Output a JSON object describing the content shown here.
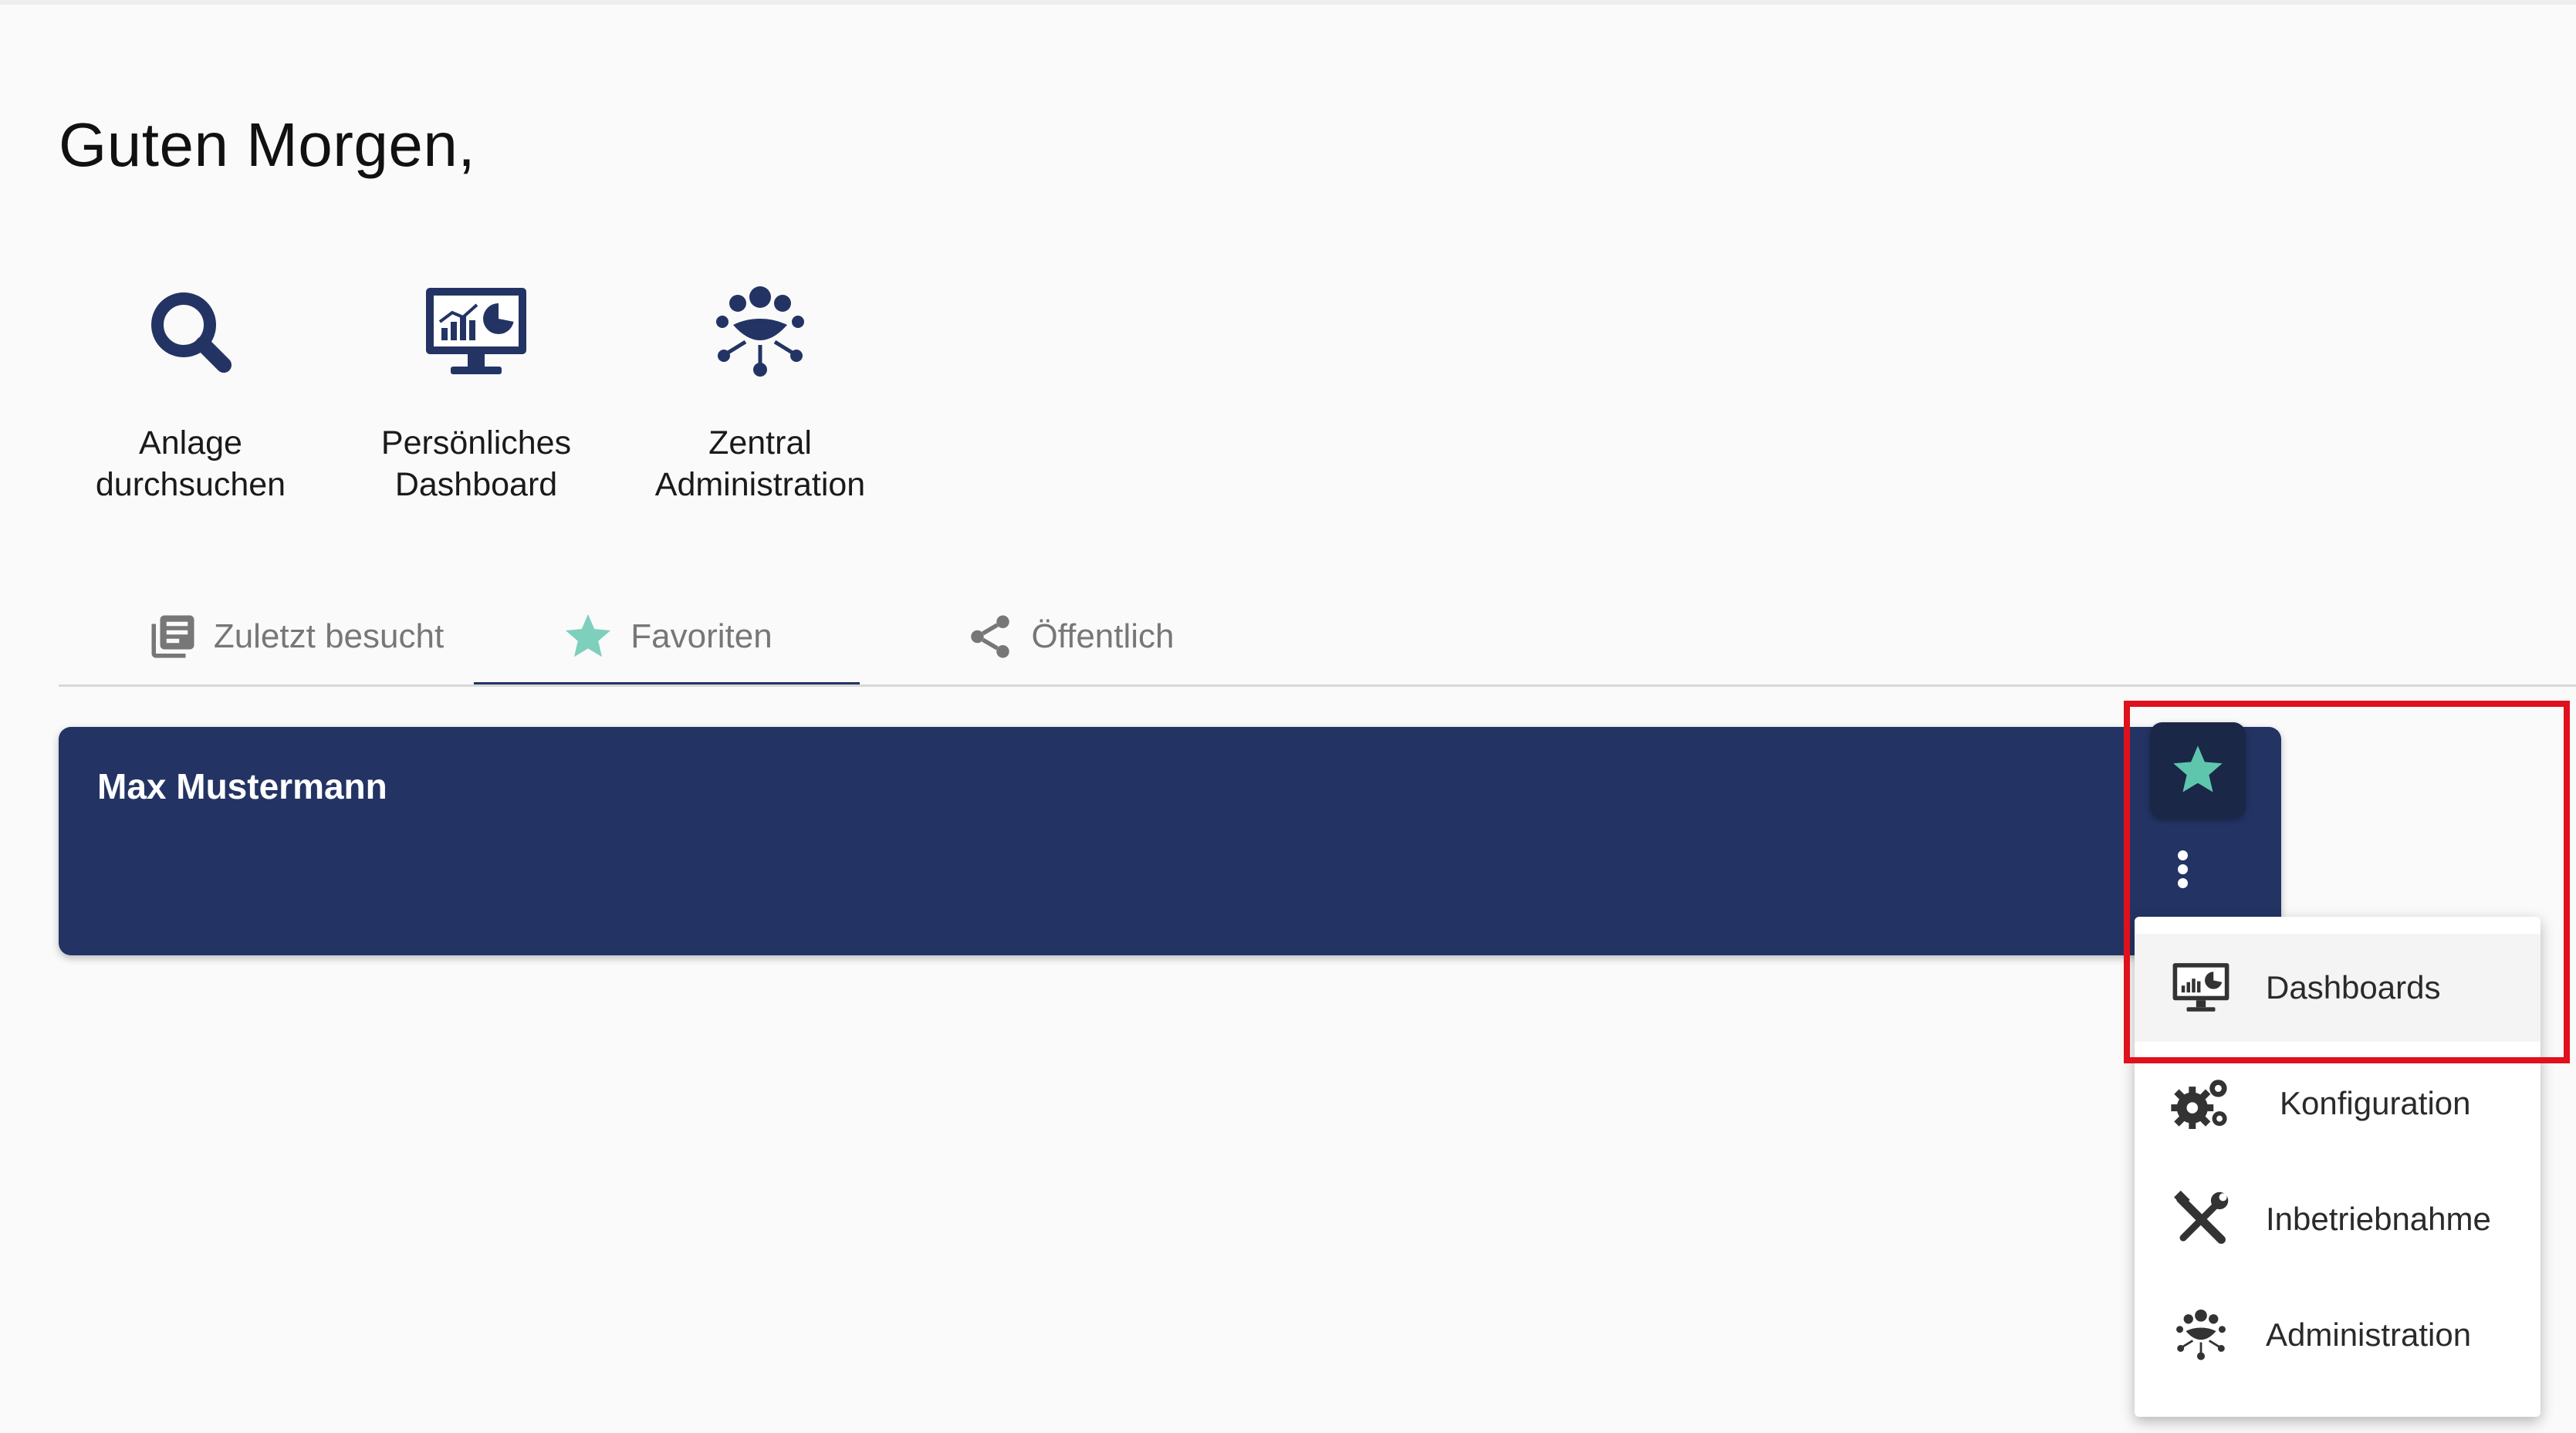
{
  "greeting": "Guten Morgen,",
  "quick_actions": [
    {
      "line1": "Anlage",
      "line2": "durchsuchen",
      "icon": "search-icon"
    },
    {
      "line1": "Persönliches",
      "line2": "Dashboard",
      "icon": "dashboard-monitor-icon"
    },
    {
      "line1": "Zentral",
      "line2": "Administration",
      "icon": "administration-network-icon"
    }
  ],
  "tabs": [
    {
      "label": "Zuletzt besucht",
      "icon": "recent-list-icon",
      "active": false
    },
    {
      "label": "Favoriten",
      "icon": "star-icon",
      "active": true
    },
    {
      "label": "Öffentlich",
      "icon": "share-icon",
      "active": false
    }
  ],
  "card": {
    "title": "Max Mustermann"
  },
  "menu": [
    {
      "label": "Dashboards",
      "icon": "dashboard-monitor-icon"
    },
    {
      "label": "Konfiguration",
      "icon": "gears-icon"
    },
    {
      "label": "Inbetriebnahme",
      "icon": "tools-icon"
    },
    {
      "label": "Administration",
      "icon": "administration-network-icon"
    }
  ],
  "colors": {
    "primary_navy": "#233464",
    "accent_teal": "#5fc6ae",
    "highlight_red": "#e0101c",
    "tab_inactive": "#777777"
  }
}
